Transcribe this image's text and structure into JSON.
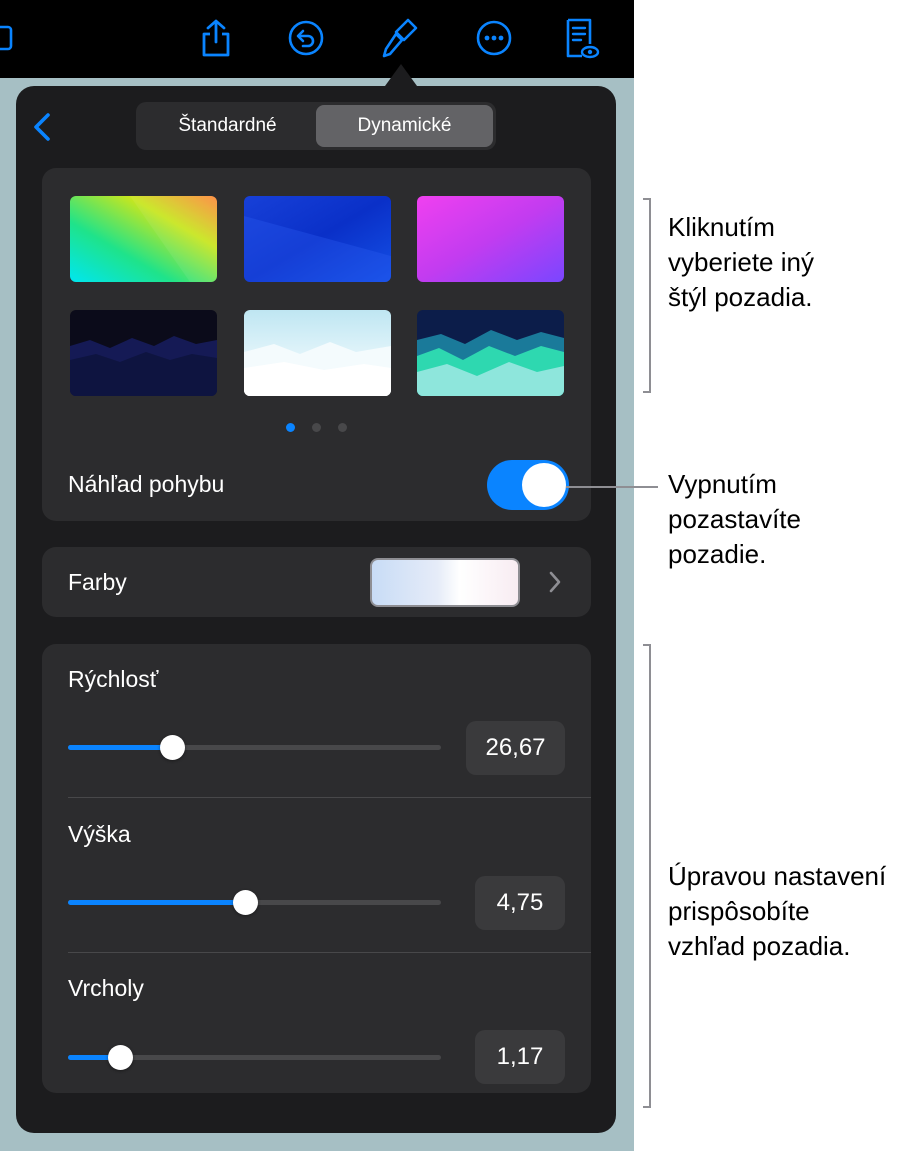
{
  "tabs": {
    "standard": "Štandardné",
    "dynamic": "Dynamické"
  },
  "styles": [
    {
      "name": "rainbow-gradient"
    },
    {
      "name": "blue-gradient"
    },
    {
      "name": "magenta-gradient"
    },
    {
      "name": "dark-mountains"
    },
    {
      "name": "white-mountains"
    },
    {
      "name": "teal-mountains"
    }
  ],
  "page_indicator": {
    "count": 3,
    "current": 1
  },
  "motion_preview": {
    "label": "Náhľad pohybu",
    "enabled": true
  },
  "colors_row": {
    "label": "Farby"
  },
  "sliders": {
    "speed": {
      "label": "Rýchlosť",
      "value": "26,67",
      "fill_percent": 28
    },
    "height": {
      "label": "Výška",
      "value": "4,75",
      "fill_percent": 47.5
    },
    "peaks": {
      "label": "Vrcholy",
      "value": "1,17",
      "fill_percent": 14
    }
  },
  "annotations": {
    "styles": "Kliknutím\nvyberiete iný\nštýl pozadia.",
    "toggle": "Vypnutím\npozastavíte\npozadie.",
    "sliders": "Úpravou nastavení\nprispôsobíte\nvzhľad pozadia."
  },
  "accent_color": "#0a84ff"
}
